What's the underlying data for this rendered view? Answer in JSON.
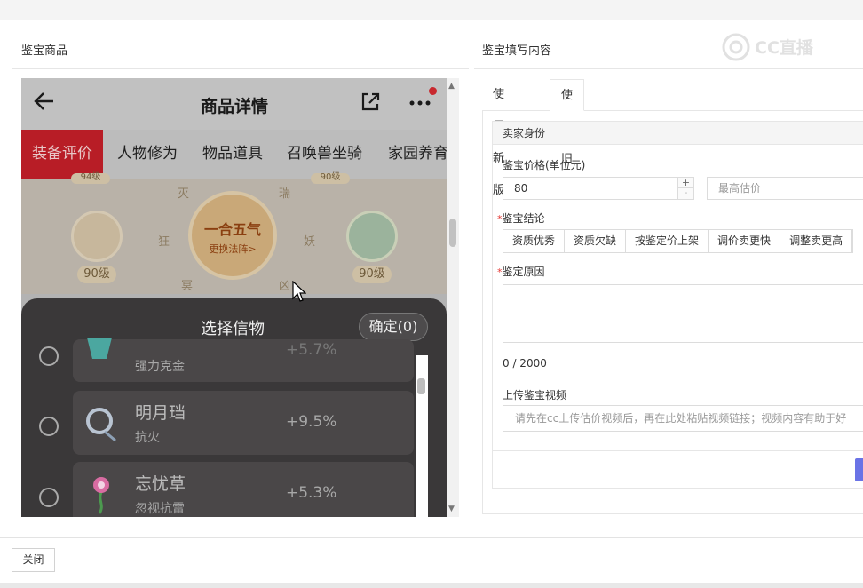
{
  "left_panel": {
    "title": "鉴宝商品"
  },
  "right_panel": {
    "title": "鉴宝填写内容"
  },
  "watermark": "CC直播",
  "phone": {
    "title": "商品详情",
    "tabs": [
      "装备评价",
      "人物修为",
      "物品道具",
      "召唤兽坐骑",
      "家园养育"
    ],
    "art": {
      "center_line1": "一合五气",
      "center_line2": "更换法阵>",
      "level_left": "90级",
      "level_right": "90级",
      "runes": [
        "灭",
        "瑞",
        "狂",
        "妖",
        "冥",
        "凶",
        "谋"
      ],
      "top_left_partial": "94级",
      "top_right_partial": "90级"
    },
    "sheet": {
      "title": "选择信物",
      "confirm": "确定(0)",
      "items": [
        {
          "name": "",
          "sub": "强力克金",
          "pct": "+5.7%"
        },
        {
          "name": "明月珰",
          "sub": "抗火",
          "pct": "+9.5%"
        },
        {
          "name": "忘忧草",
          "sub": "忽视抗雷",
          "pct": "+5.3%"
        }
      ]
    }
  },
  "form": {
    "tabs": [
      "使用新版",
      "使用旧版"
    ],
    "active_tab": "使用旧版",
    "section_header": "卖家身份",
    "price_label": "鉴宝价格(单位元)",
    "price_value": "80",
    "max_price_placeholder": "最高估价",
    "conclusion_label": "鉴宝结论",
    "conclusion_options": [
      "资质优秀",
      "资质欠缺",
      "按鉴定价上架",
      "调价卖更快",
      "调整卖更高"
    ],
    "reason_label": "鉴定原因",
    "counter": "0 / 2000",
    "video_label": "上传鉴宝视频",
    "video_placeholder": "请先在cc上传估价视频后，再在此处粘贴视频链接；视频内容有助于好"
  },
  "footer": {
    "close": "关闭"
  }
}
